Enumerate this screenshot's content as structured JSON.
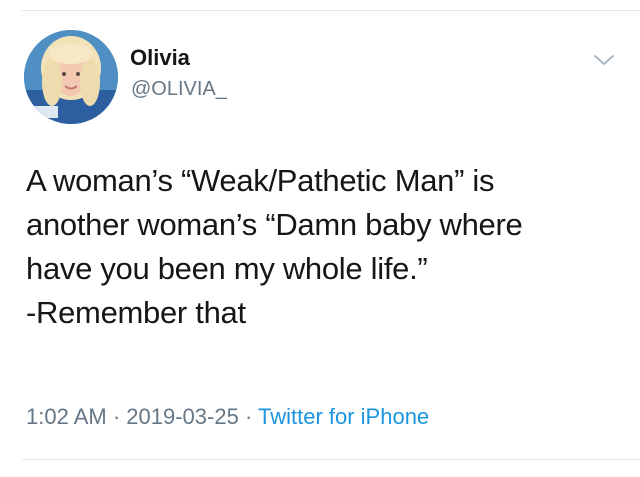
{
  "author": {
    "name": "Olivia",
    "handle": "@OLIVIA_",
    "avatar_icon": "profile-photo"
  },
  "menu": {
    "icon": "chevron-down-icon"
  },
  "tweet": {
    "lines": [
      "A woman’s “Weak/Pathetic Man” is",
      "another woman’s “Damn baby where",
      "have you been my whole life.”",
      "-Remember that"
    ]
  },
  "meta": {
    "time": "1:02 AM",
    "sep1": " · ",
    "date": "2019-03-25",
    "sep2": " · ",
    "source": "Twitter for iPhone"
  },
  "colors": {
    "text": "#14171a",
    "secondary": "#657786",
    "link": "#1b95e0",
    "divider": "#e1e8ed"
  }
}
